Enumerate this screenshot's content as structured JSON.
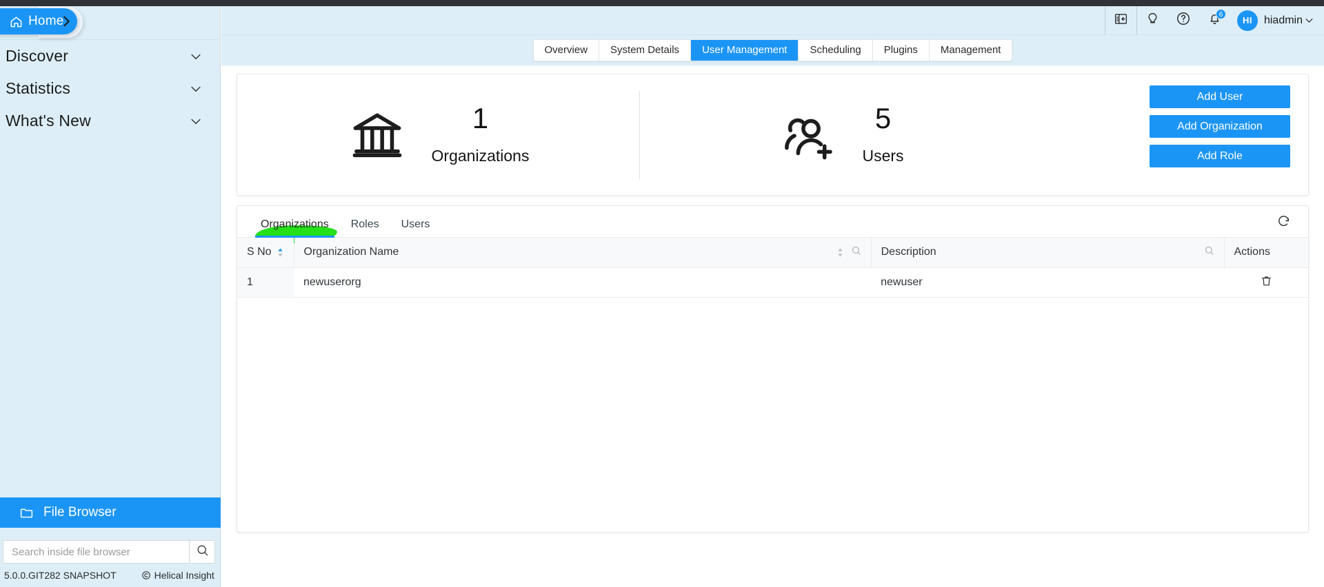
{
  "sidebar": {
    "home_label": "Home",
    "nav_items": [
      {
        "label": "Discover"
      },
      {
        "label": "Statistics"
      },
      {
        "label": "What's New"
      }
    ],
    "file_browser_label": "File Browser",
    "search_placeholder": "Search inside file browser",
    "search_value": "",
    "version": "5.0.0.GIT282 SNAPSHOT",
    "brand": "Helical Insight"
  },
  "header": {
    "notification_count": "6",
    "avatar_initials": "HI",
    "user_name": "hiadmin"
  },
  "tabs": [
    {
      "label": "Overview",
      "active": false
    },
    {
      "label": "System Details",
      "active": false
    },
    {
      "label": "User Management",
      "active": true
    },
    {
      "label": "Scheduling",
      "active": false
    },
    {
      "label": "Plugins",
      "active": false
    },
    {
      "label": "Management",
      "active": false
    }
  ],
  "stats": [
    {
      "value": "1",
      "label": "Organizations",
      "icon": "bank-icon"
    },
    {
      "value": "5",
      "label": "Users",
      "icon": "add-users-icon"
    }
  ],
  "actions": {
    "add_user": "Add User",
    "add_organization": "Add Organization",
    "add_role": "Add Role"
  },
  "inner_tabs": [
    {
      "label": "Organizations",
      "active": true,
      "highlighted": true
    },
    {
      "label": "Roles",
      "active": false,
      "highlighted": false
    },
    {
      "label": "Users",
      "active": false,
      "highlighted": false
    }
  ],
  "table": {
    "columns": [
      "S No",
      "Organization Name",
      "Description",
      "Actions"
    ],
    "rows": [
      {
        "sno": "1",
        "name": "newuserorg",
        "description": "newuser"
      }
    ]
  },
  "colors": {
    "accent": "#1b95f5",
    "sidebar_bg": "#ddeef8",
    "top_strip": "#2f3338",
    "highlighter": "#25e019"
  }
}
